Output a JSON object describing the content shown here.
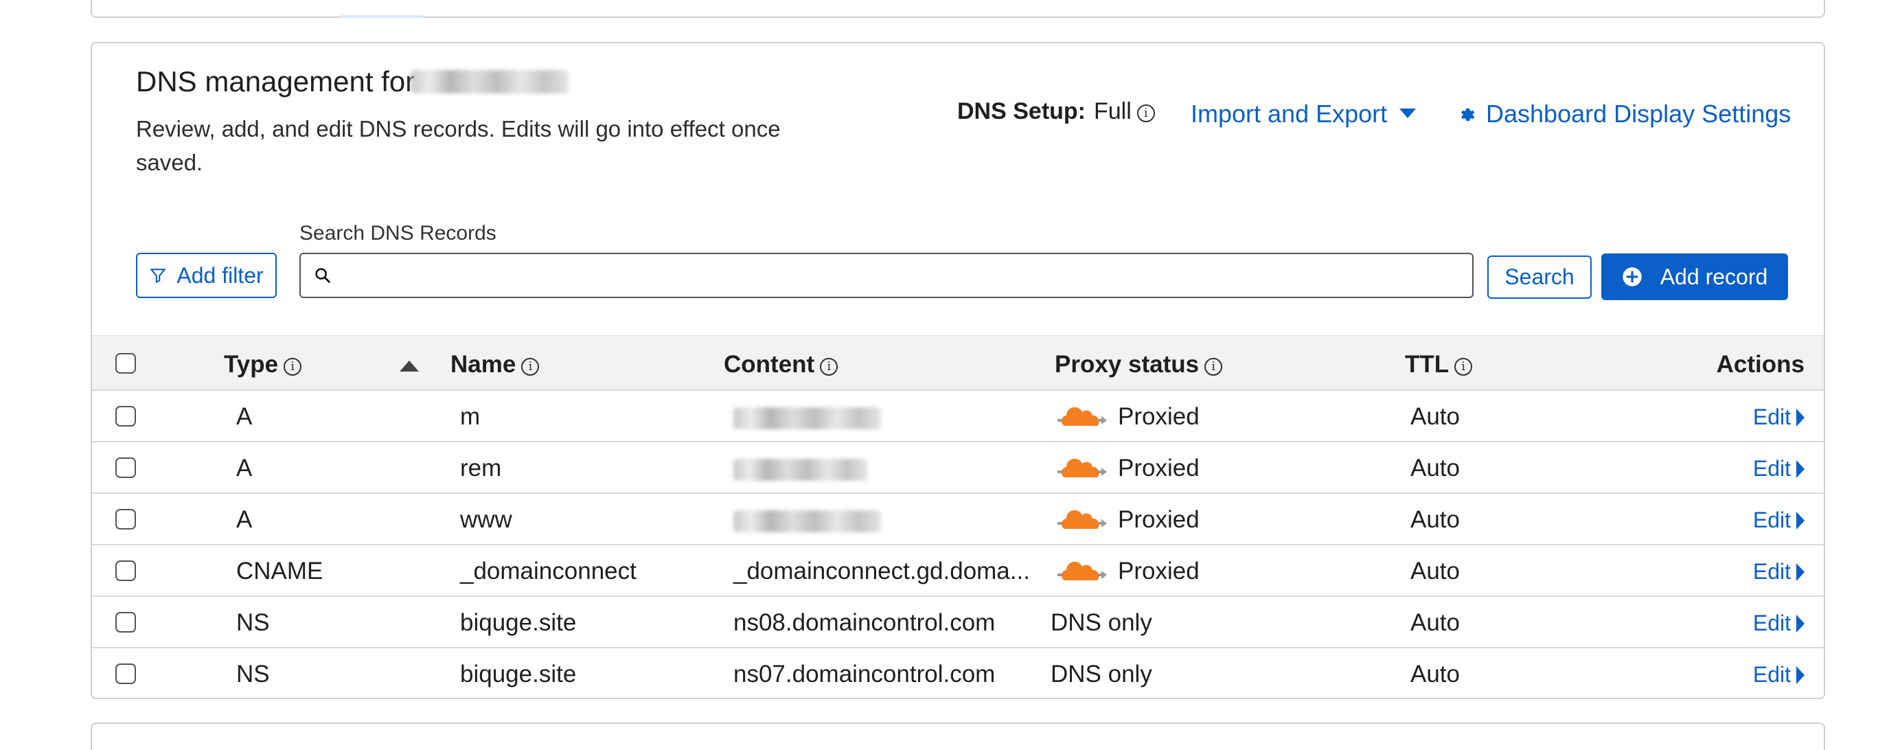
{
  "header": {
    "title": "DNS management for",
    "subtitle": "Review, add, and edit DNS records. Edits will go into effect once saved.",
    "dns_setup_label": "DNS Setup:",
    "dns_setup_value": "Full",
    "import_export": "Import and Export",
    "dashboard_settings": "Dashboard Display Settings"
  },
  "search": {
    "label": "Search DNS Records",
    "placeholder": "",
    "button": "Search",
    "add_filter": "Add filter",
    "add_record": "Add record"
  },
  "table": {
    "headers": {
      "type": "Type",
      "name": "Name",
      "content": "Content",
      "proxy_status": "Proxy status",
      "ttl": "TTL",
      "actions": "Actions"
    },
    "edit_label": "Edit",
    "rows": [
      {
        "type": "A",
        "name": "m",
        "content": "",
        "proxy": "Proxied",
        "ttl": "Auto"
      },
      {
        "type": "A",
        "name": "rem",
        "content": "",
        "proxy": "Proxied",
        "ttl": "Auto"
      },
      {
        "type": "A",
        "name": "www",
        "content": "",
        "proxy": "Proxied",
        "ttl": "Auto"
      },
      {
        "type": "CNAME",
        "name": "_domainconnect",
        "content": "_domainconnect.gd.doma...",
        "proxy": "Proxied",
        "ttl": "Auto"
      },
      {
        "type": "NS",
        "name": "biquge.site",
        "content": "ns08.domaincontrol.com",
        "proxy": "DNS only",
        "ttl": "Auto"
      },
      {
        "type": "NS",
        "name": "biquge.site",
        "content": "ns07.domaincontrol.com",
        "proxy": "DNS only",
        "ttl": "Auto"
      }
    ]
  },
  "icons": {
    "info": "info-icon",
    "caret": "caret-down-icon",
    "gear": "gear-icon",
    "filter": "filter-icon",
    "search": "search-icon",
    "add": "plus-circle-icon",
    "sort": "sort-asc-icon",
    "proxied": "cloud-icon",
    "edit_caret": "caret-right-icon"
  },
  "colors": {
    "accent": "#0a5fc8",
    "cloud": "#f38020",
    "header_bg": "#f2f2f2"
  }
}
